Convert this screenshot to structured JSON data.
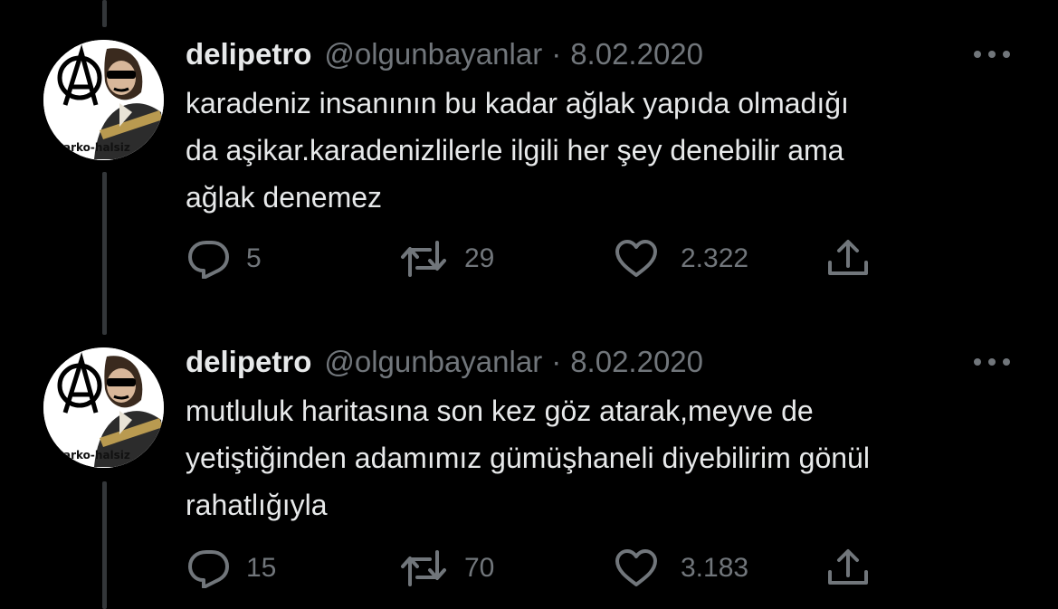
{
  "tweets": [
    {
      "display_name": "delipetro",
      "handle": "@olgunbayanlar",
      "separator": "·",
      "date": "8.02.2020",
      "avatar_caption": "arko-halsiz",
      "text_lines": [
        "karadeniz insanının bu kadar ağlak yapıda olmadığı",
        "da aşikar.karadenizlilerle ilgili her şey denebilir ama",
        "ağlak denemez"
      ],
      "replies": "5",
      "retweets": "29",
      "likes": "2.322"
    },
    {
      "display_name": "delipetro",
      "handle": "@olgunbayanlar",
      "separator": "·",
      "date": "8.02.2020",
      "avatar_caption": "arko-halsiz",
      "text_lines": [
        "mutluluk haritasına son kez göz atarak,meyve de",
        "yetiştiğinden adamımız gümüşhaneli diyebilirim gönül",
        "rahatlığıyla"
      ],
      "replies": "15",
      "retweets": "70",
      "likes": "3.183"
    }
  ],
  "icons": {
    "reply": "reply-icon",
    "retweet": "retweet-icon",
    "like": "heart-icon",
    "share": "share-icon",
    "more": "more-icon"
  },
  "colors": {
    "background": "#000000",
    "text": "#e7e9ea",
    "secondary": "#71767b",
    "thread_line": "#333639"
  }
}
